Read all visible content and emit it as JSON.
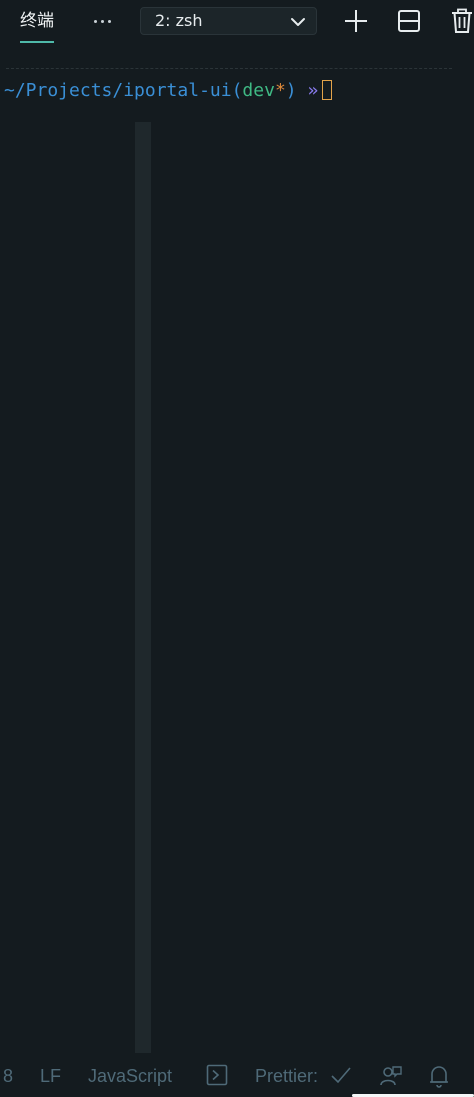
{
  "header": {
    "active_tab_label": "终端",
    "more_icon": "more-horizontal-icon",
    "shell_select": {
      "value": "2: zsh",
      "icon": "chevron-down-icon"
    },
    "actions": [
      {
        "name": "add-terminal",
        "icon": "plus-icon"
      },
      {
        "name": "split-terminal",
        "icon": "split-icon"
      },
      {
        "name": "delete-terminal",
        "icon": "trash-icon"
      }
    ],
    "accent_color": "#4fb9a9"
  },
  "terminal": {
    "prompt_path": "~/Projects/iportal-ui",
    "prompt_open_paren": "(",
    "prompt_branch": "dev",
    "prompt_dirty_marker": "*",
    "prompt_close_paren": ")",
    "prompt_arrow": "»",
    "colors": {
      "path": "#3a8fd6",
      "branch": "#3fb984",
      "dirty": "#e08a3b",
      "arrow": "#8a7cf0",
      "cursor": "#e3a34a"
    }
  },
  "status_bar": {
    "partial_item": "8",
    "line_ending": "LF",
    "language": "JavaScript",
    "terminal_icon": "terminal-icon",
    "prettier_label": "Prettier:",
    "prettier_status_icon": "checkmark-icon",
    "feedback_icon": "feedback-icon",
    "bell_icon": "bell-icon"
  }
}
